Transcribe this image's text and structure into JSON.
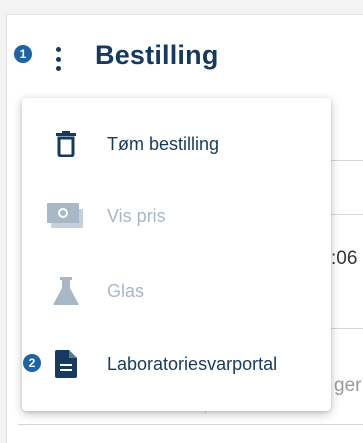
{
  "header": {
    "badge_1": "1",
    "title": "Bestilling"
  },
  "background": {
    "time_fragment": ":06",
    "text_fragment": "ger"
  },
  "menu": {
    "badge_2": "2",
    "items": [
      {
        "label": "Tøm bestilling",
        "icon": "trash-icon",
        "enabled": true
      },
      {
        "label": "Vis pris",
        "icon": "money-icon",
        "enabled": false
      },
      {
        "label": "Glas",
        "icon": "flask-icon",
        "enabled": false
      },
      {
        "label": "Laboratoriesvarportal",
        "icon": "document-icon",
        "enabled": true
      }
    ]
  },
  "colors": {
    "primary": "#163a5f",
    "badge": "#1f63a5",
    "disabled": "#a9b8c6"
  }
}
